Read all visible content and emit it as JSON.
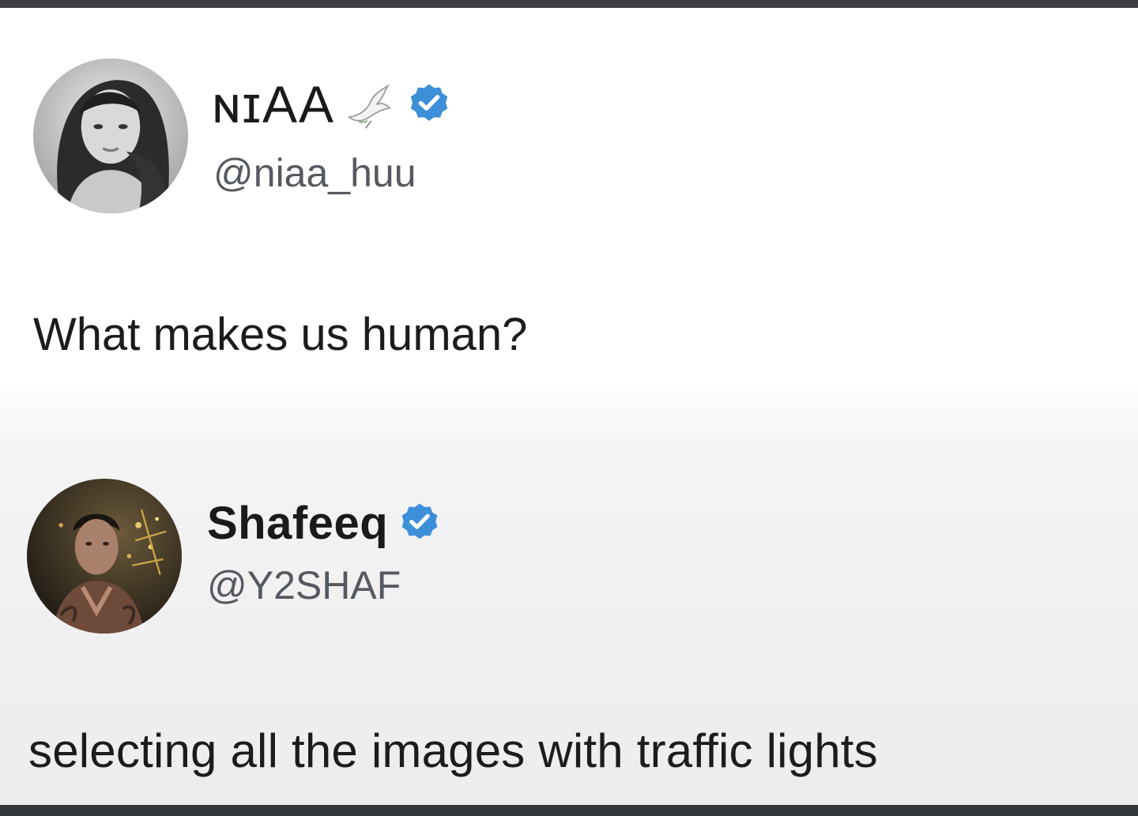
{
  "posts": [
    {
      "author": {
        "display_name": "ɴɪAA",
        "handle": "@niaa_huu",
        "verified": true,
        "avatar": "woman-portrait-avatar",
        "name_emoji": "dove-icon"
      },
      "text": "What makes us human?"
    },
    {
      "author": {
        "display_name": "Shafeeq",
        "handle": "@Y2SHAF",
        "verified": true,
        "avatar": "man-portrait-avatar"
      },
      "text": "selecting all the images with traffic lights"
    }
  ],
  "colors": {
    "verified_badge": "#3d8fd8",
    "text_primary": "#1c1c1e",
    "text_secondary": "#555a60",
    "frame_border": "#3b3d40"
  }
}
